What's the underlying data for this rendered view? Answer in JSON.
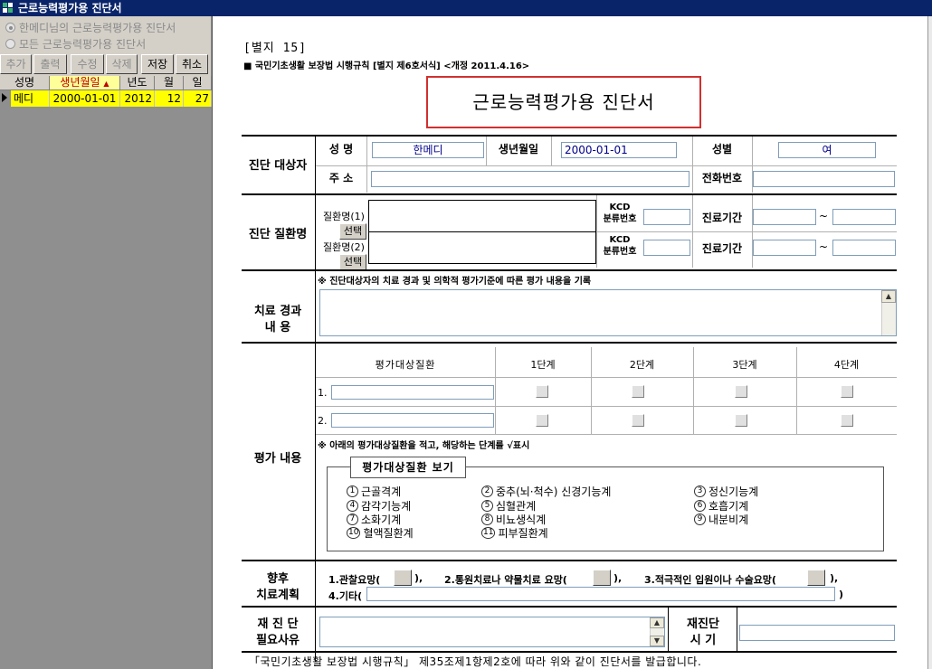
{
  "window": {
    "title": "근로능력평가용 진단서"
  },
  "left": {
    "radio1": "한메디님의 근로능력평가용 진단서",
    "radio2": "모든 근로능력평가용 진단서",
    "buttons": {
      "add": "추가",
      "print": "출력",
      "edit": "수정",
      "delete": "삭제",
      "save": "저장",
      "cancel": "취소"
    },
    "columns": [
      "성명",
      "생년월일",
      "년도",
      "월",
      "일"
    ],
    "sort_indicator": "▲",
    "rows": [
      {
        "name": "메디",
        "birth": "2000-01-01",
        "year": "2012",
        "month": "12",
        "day": "27"
      }
    ]
  },
  "form": {
    "form_no": "[별지 15]",
    "law_ref": "■ 국민기초생활 보장법 시행규칙 [별지 제6호서식] <개정 2011.4.16>",
    "title": "근로능력평가용 진단서",
    "subject": {
      "section_label": "진단 대상자",
      "name_label": "성 명",
      "name_value": "한메디",
      "birth_label": "생년월일",
      "birth_value": "2000-01-01",
      "sex_label": "성별",
      "sex_value": "여",
      "address_label": "주 소",
      "address_value": "",
      "phone_label": "전화번호",
      "phone_value": ""
    },
    "disease": {
      "section_label": "진단 질환명",
      "d1_label": "질환명(1)",
      "d2_label": "질환명(2)",
      "select_label": "선택",
      "kcd_label1": "KCD",
      "kcd_label2": "분류번호",
      "period_label": "진료기간",
      "tilde": "~"
    },
    "treatment": {
      "section_label1": "치료 경과",
      "section_label2": "내 용",
      "note": "※ 진단대상자의 치료 경과 및 의학적 평가기준에 따른 평가 내용을 기록"
    },
    "evaluation": {
      "section_label": "평가 내용",
      "col_header": "평가대상질환",
      "stages": [
        "1단계",
        "2단계",
        "3단계",
        "4단계"
      ],
      "row1": "1.",
      "row2": "2.",
      "note": "※ 아래의 평가대상질환을 적고, 해당하는 단계를 √표시",
      "view_title": "평가대상질환 보기",
      "diseases": [
        {
          "no": "1",
          "name": "근골격계"
        },
        {
          "no": "2",
          "name": "중추(뇌·척수) 신경기능계"
        },
        {
          "no": "3",
          "name": "정신기능계"
        },
        {
          "no": "4",
          "name": "감각기능계"
        },
        {
          "no": "5",
          "name": "심혈관계"
        },
        {
          "no": "6",
          "name": "호흡기계"
        },
        {
          "no": "7",
          "name": "소화기계"
        },
        {
          "no": "8",
          "name": "비뇨생식계"
        },
        {
          "no": "9",
          "name": "내분비계"
        },
        {
          "no": "10",
          "name": "혈액질환계"
        },
        {
          "no": "11",
          "name": "피부질환계"
        }
      ]
    },
    "plan": {
      "section_label1": "향후",
      "section_label2": "치료계획",
      "opt1": "1.관찰요망(",
      "opt2": "2.통원치료나 약물치료 요망(",
      "opt3": "3.적극적인 입원이나 수술요망(",
      "close": "),",
      "close_last": "),",
      "opt4": "4.기타(",
      "opt4_close": ")"
    },
    "rediag": {
      "section_label1": "재 진 단",
      "section_label2": "필요사유",
      "timing_label1": "재진단",
      "timing_label2": "시 기"
    },
    "footer": "「국민기초생활 보장법 시행규칙」 제35조제1항제2호에 따라 위와 같이 진단서를 발급합니다."
  }
}
